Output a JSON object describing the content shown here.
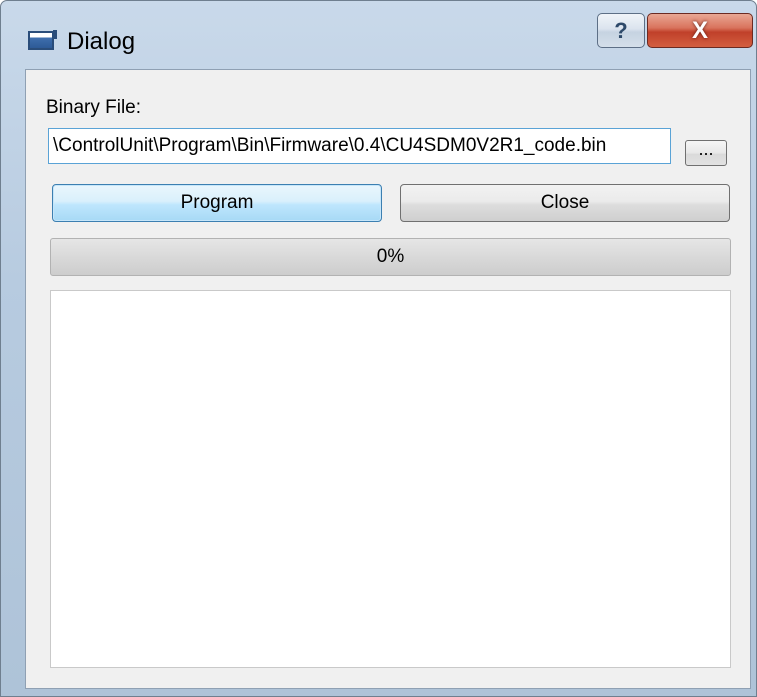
{
  "window": {
    "title": "Dialog",
    "help_label": "?",
    "close_label": "X"
  },
  "form": {
    "binary_file_label": "Binary File:",
    "binary_file_path": "\\ControlUnit\\Program\\Bin\\Firmware\\0.4\\CU4SDM0V2R1_code.bin",
    "browse_label": "...",
    "program_label": "Program",
    "close_label": "Close"
  },
  "progress": {
    "value": 0,
    "text": "0%"
  },
  "log": {
    "text": ""
  }
}
